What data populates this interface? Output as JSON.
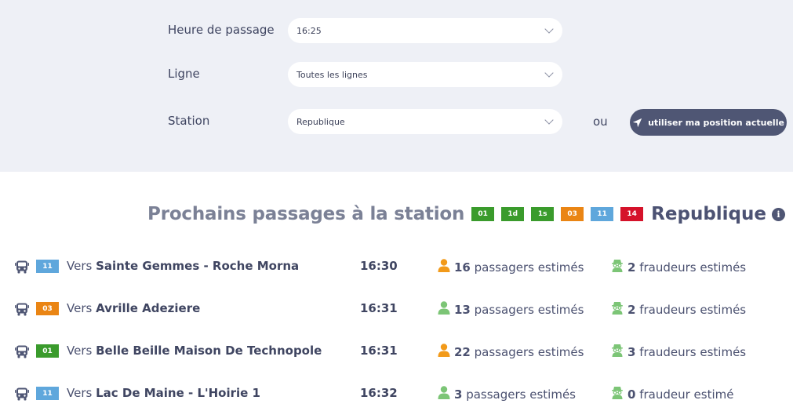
{
  "filters": {
    "time_label": "Heure de passage",
    "time_value": "16:25",
    "line_label": "Ligne",
    "line_value": "Toutes les lignes",
    "station_label": "Station",
    "station_value": "Republique",
    "or_text": "ou",
    "position_button": "utiliser ma position actuelle"
  },
  "heading": {
    "title": "Prochains passages à la station",
    "lines": [
      {
        "label": "01",
        "color": "#3a9b2c"
      },
      {
        "label": "1d",
        "color": "#3a9b2c"
      },
      {
        "label": "1s",
        "color": "#3a9b2c"
      },
      {
        "label": "03",
        "color": "#ea8514"
      },
      {
        "label": "11",
        "color": "#5fa7dc"
      },
      {
        "label": "14",
        "color": "#d5122a"
      }
    ],
    "station": "Republique",
    "info_glyph": "i"
  },
  "departures": [
    {
      "line": "11",
      "line_color": "#5fa7dc",
      "prefix": "Vers",
      "destination": "Sainte Gemmes - Roche Morna",
      "time": "16:30",
      "passengers_count": "16",
      "passengers_text": "passagers estimés",
      "passenger_icon_color": "#f29a1a",
      "fraud_count": "2",
      "fraud_text": "fraudeurs estimés"
    },
    {
      "line": "03",
      "line_color": "#ea8514",
      "prefix": "Vers",
      "destination": "Avrille Adeziere",
      "time": "16:31",
      "passengers_count": "13",
      "passengers_text": "passagers estimés",
      "passenger_icon_color": "#7cc576",
      "fraud_count": "2",
      "fraud_text": "fraudeurs estimés"
    },
    {
      "line": "01",
      "line_color": "#3a9b2c",
      "prefix": "Vers",
      "destination": "Belle Beille Maison De Technopole",
      "time": "16:31",
      "passengers_count": "22",
      "passengers_text": "passagers estimés",
      "passenger_icon_color": "#f29a1a",
      "fraud_count": "3",
      "fraud_text": "fraudeurs estimés"
    },
    {
      "line": "11",
      "line_color": "#5fa7dc",
      "prefix": "Vers",
      "destination": "Lac De Maine - L'Hoirie 1",
      "time": "16:32",
      "passengers_count": "3",
      "passengers_text": "passagers estimés",
      "passenger_icon_color": "#7cc576",
      "fraud_count": "0",
      "fraud_text": "fraudeur estimé"
    }
  ],
  "icons": {
    "bus": "bus-icon",
    "passenger": "person-icon",
    "fraud": "spy-icon",
    "location": "location-arrow-icon",
    "info": "info-icon"
  }
}
